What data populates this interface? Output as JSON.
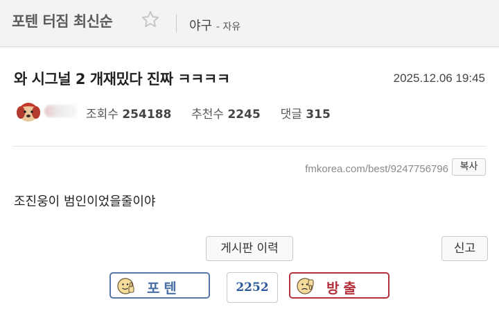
{
  "board": {
    "title": "포텐 터짐 최신순",
    "category": "야구",
    "subcategory": "- 자유"
  },
  "post": {
    "title": "와 시그널 2 개재밌다 진짜 ㅋㅋㅋㅋ",
    "date": "2025.12.06 19:45",
    "stats": {
      "views_label": "조회수",
      "views": "254188",
      "recommends_label": "추천수",
      "recommends": "2245",
      "comments_label": "댓글",
      "comments": "315"
    },
    "url": "fmkorea.com/best/9247756796",
    "copy_label": "복사",
    "content": "조진웅이 범인이었을줄이야"
  },
  "actions": {
    "history_label": "게시판 이력",
    "report_label": "신고",
    "upvote_label": "포텐",
    "vote_count": "2252",
    "downvote_label": "방출"
  },
  "colors": {
    "upvote": "#4a6fa5",
    "downvote": "#b5303a",
    "count": "#2a5a9a"
  },
  "icons": [
    "star-icon",
    "avatar",
    "thumbs-up-face-icon",
    "thumbs-down-face-icon"
  ]
}
